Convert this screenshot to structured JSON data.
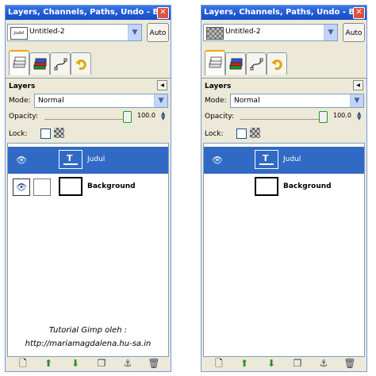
{
  "panels": [
    {
      "title": "Layers, Channels, Paths, Undo - B...",
      "image_combo": {
        "thumb_text": "Judul",
        "name": "Untitled-2"
      },
      "auto_label": "Auto",
      "section_title": "Layers",
      "mode_label": "Mode:",
      "mode_value": "Normal",
      "opacity_label": "Opacity:",
      "opacity_value": "100.0",
      "lock_label": "Lock:",
      "layers": [
        {
          "name": "Judul",
          "visible": true
        },
        {
          "name": "Background",
          "visible": true
        }
      ],
      "watermark_lines": [
        "Tutorial Gimp oleh :",
        "http://mariamagdalena.hu-sa.in"
      ]
    },
    {
      "title": "Layers, Channels, Paths, Undo - B...",
      "image_combo": {
        "thumb_text": "",
        "name": "Untitled-2"
      },
      "auto_label": "Auto",
      "section_title": "Layers",
      "mode_label": "Mode:",
      "mode_value": "Normal",
      "opacity_label": "Opacity:",
      "opacity_value": "100.0",
      "lock_label": "Lock:",
      "layers": [
        {
          "name": "Judul",
          "visible": true
        },
        {
          "name": "Background",
          "visible": false
        }
      ]
    }
  ],
  "tabs": [
    "layers-tab",
    "channels-tab",
    "paths-tab",
    "undo-tab"
  ],
  "bottom_toolbar": [
    "new-layer-icon",
    "raise-layer-icon",
    "lower-layer-icon",
    "duplicate-layer-icon",
    "anchor-layer-icon",
    "delete-layer-icon"
  ],
  "colors": {
    "title_bar": "#1e57d3",
    "selected_row": "#316ac5",
    "panel_bg": "#ece9d8"
  }
}
